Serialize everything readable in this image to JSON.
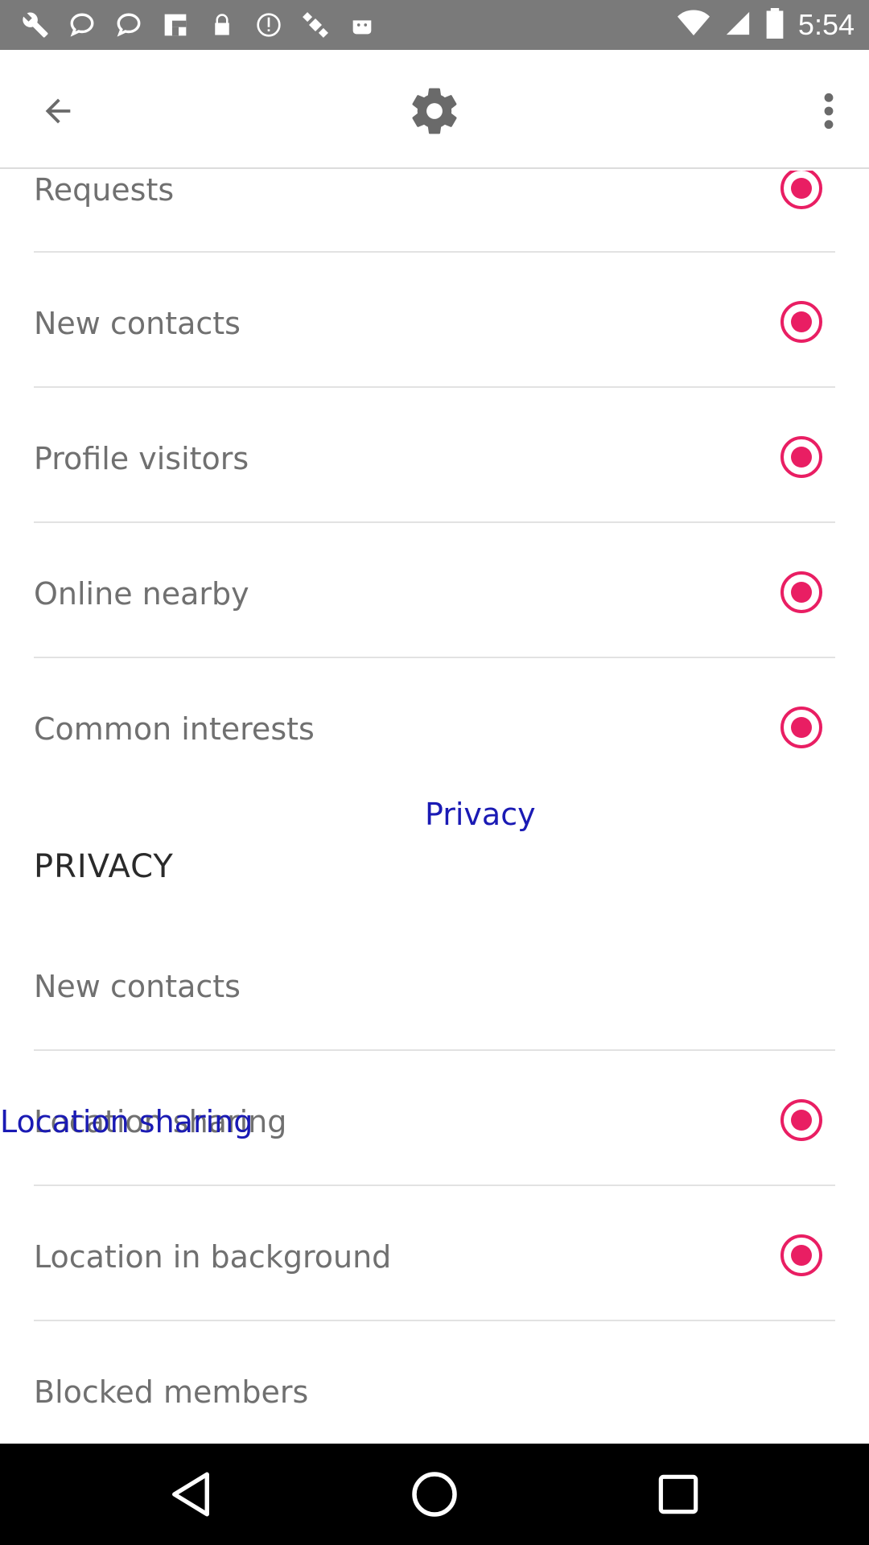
{
  "status_bar": {
    "time": "5:54",
    "left_icons": [
      "wrench-icon",
      "chat-bubble-icon",
      "chat-bubble-icon",
      "flipboard-icon",
      "lock-icon",
      "info-circle-icon",
      "satellite-icon",
      "android-icon"
    ],
    "right_icons": [
      "wifi-icon",
      "signal-icon",
      "battery-icon"
    ]
  },
  "app_bar": {
    "back_icon": "arrow-back-icon",
    "center_icon": "settings-gear-icon",
    "more_icon": "more-vert-icon"
  },
  "notifications": {
    "items": [
      {
        "label": "Requests",
        "checked": true
      },
      {
        "label": "New contacts",
        "checked": true
      },
      {
        "label": "Profile visitors",
        "checked": true
      },
      {
        "label": "Online nearby",
        "checked": true
      },
      {
        "label": "Common interests",
        "checked": true
      }
    ]
  },
  "overlay": {
    "privacy_text": "Privacy",
    "location_text": "Location sharing"
  },
  "privacy": {
    "header": "PRIVACY",
    "items": [
      {
        "label": "New contacts"
      },
      {
        "label": "Location sharing",
        "checked": true
      },
      {
        "label": "Location in background",
        "checked": true
      },
      {
        "label": "Blocked members"
      }
    ]
  },
  "colors": {
    "accent": "#e91e63",
    "overlay_text": "#1a1ab4",
    "status_bar": "#7a7a7a"
  }
}
